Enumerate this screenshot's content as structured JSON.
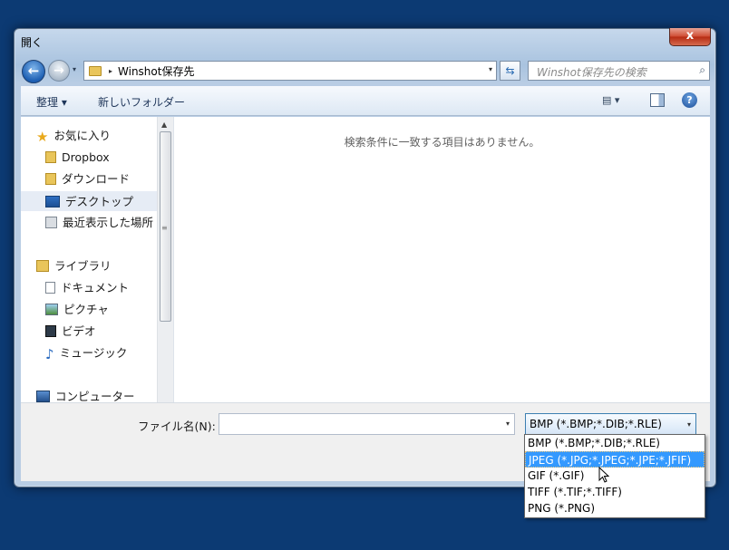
{
  "window": {
    "title": "開く",
    "close_label": "x"
  },
  "nav": {
    "back_glyph": "←",
    "forward_glyph": "→",
    "history_dropdown": "▾",
    "address_separator": "▸",
    "address_path": "Winshot保存先",
    "address_dropdown": "▾",
    "refresh_glyph": "⇆",
    "search_placeholder": "Winshot保存先の検索",
    "search_glyph": "⌕"
  },
  "toolbar": {
    "organize_label": "整理 ▾",
    "new_folder_label": "新しいフォルダー",
    "view_label": "▤ ▾",
    "help_glyph": "?"
  },
  "sidebar": {
    "favorites": "お気に入り",
    "dropbox": "Dropbox",
    "downloads": "ダウンロード",
    "desktop": "デスクトップ",
    "recent": "最近表示した場所",
    "libraries": "ライブラリ",
    "documents": "ドキュメント",
    "pictures": "ピクチャ",
    "videos": "ビデオ",
    "music": "ミュージック",
    "computer": "コンピューター"
  },
  "scrollbar": {
    "up_arrow": "▲",
    "down_arrow": "▼",
    "grip": "≡"
  },
  "content": {
    "empty_message": "検索条件に一致する項目はありません。"
  },
  "bottom": {
    "filename_label": "ファイル名(N):",
    "filename_value": "",
    "filename_dropdown": "▾",
    "filetype_selected": "BMP (*.BMP;*.DIB;*.RLE)",
    "filetype_dropdown": "▾"
  },
  "filetype_options": [
    "BMP (*.BMP;*.DIB;*.RLE)",
    "JPEG (*.JPG;*.JPEG;*.JPE;*.JFIF)",
    "GIF (*.GIF)",
    "TIFF (*.TIF;*.TIFF)",
    "PNG (*.PNG)"
  ],
  "colors": {
    "desktop": "#0c3a73",
    "selection": "#3399ff",
    "accent": "#3c7fb1"
  }
}
